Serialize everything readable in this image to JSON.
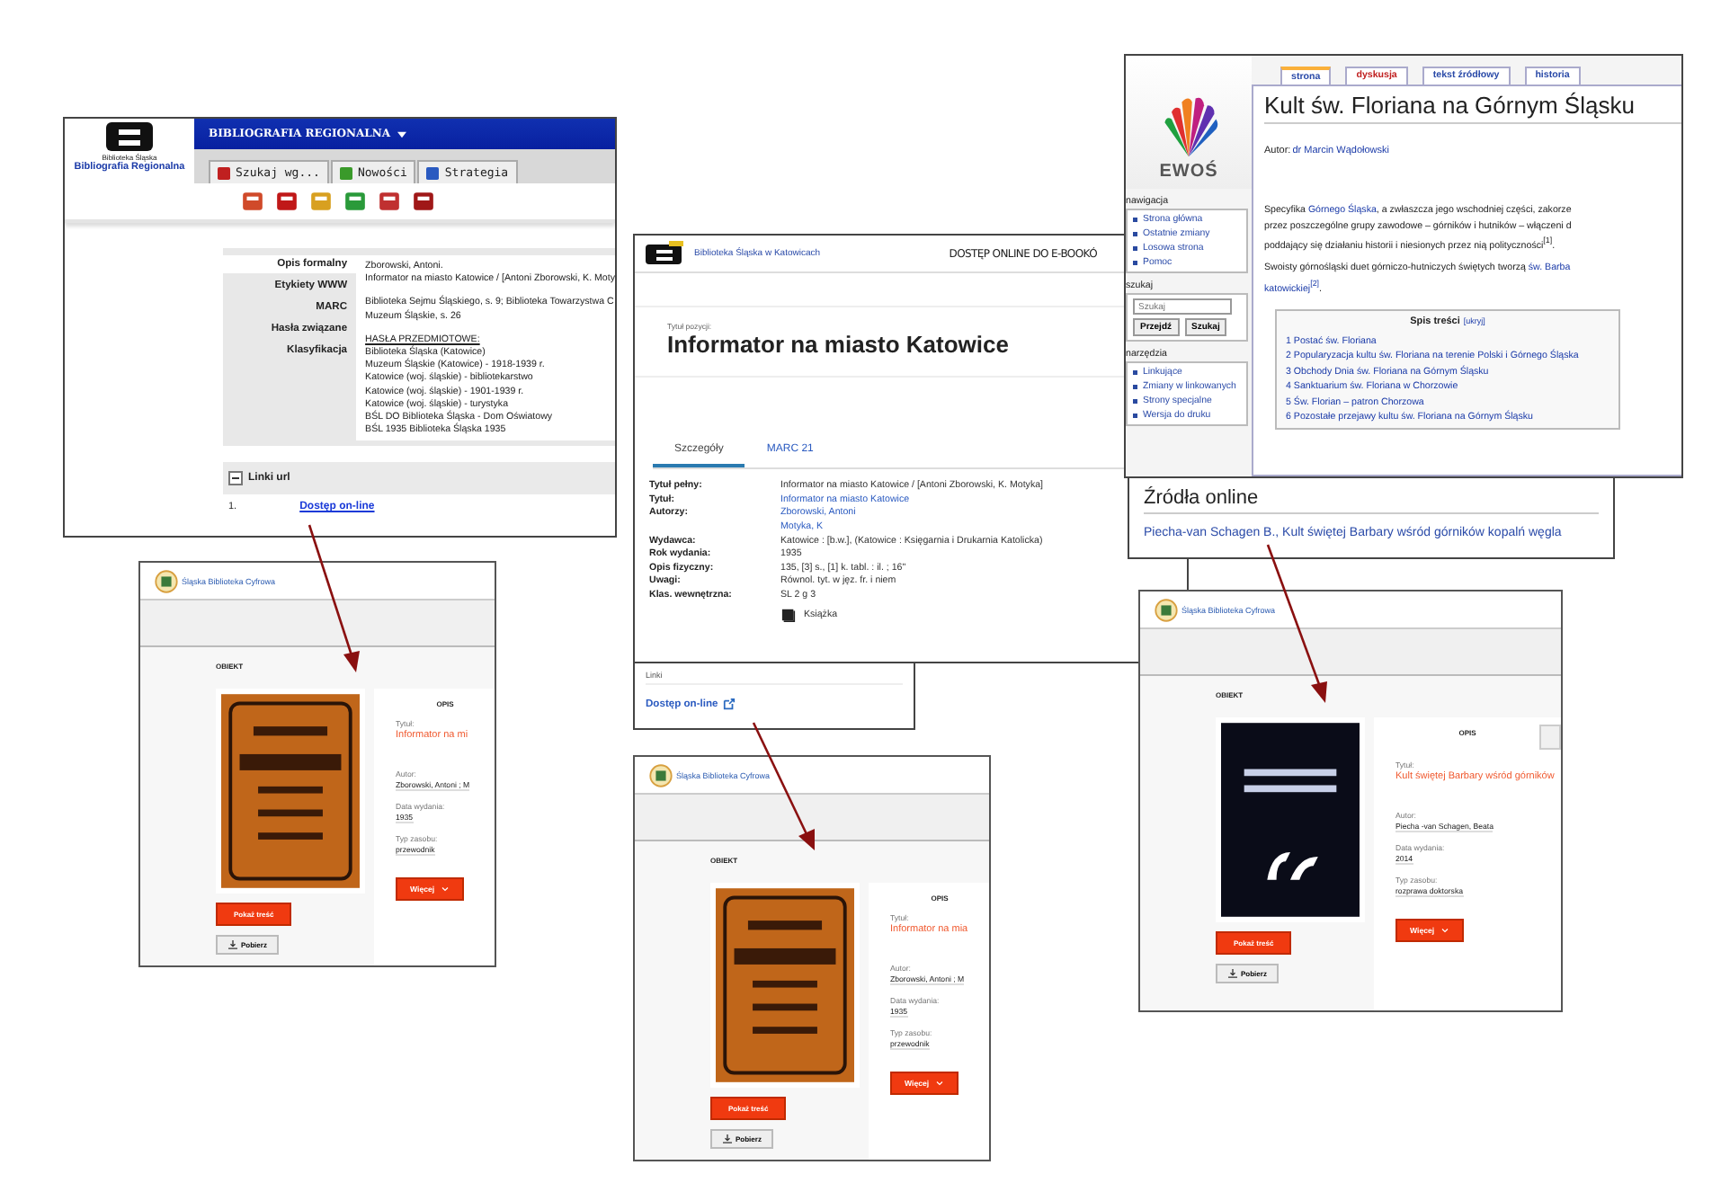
{
  "bibliography_window": {
    "logo_caption": "Biblioteka Śląska",
    "logo_title": "Bibliografia Regionalna",
    "menu_title": "BIBLIOGRAFIA REGIONALNA",
    "tabs": [
      {
        "label": "Szukaj wg...",
        "selected": false
      },
      {
        "label": "Nowości",
        "selected": false
      },
      {
        "label": "Strategia",
        "selected": false
      }
    ],
    "side_tabs": [
      {
        "label": "Opis formalny",
        "selected": true
      },
      {
        "label": "Etykiety WWW",
        "selected": false
      },
      {
        "label": "MARC",
        "selected": false
      },
      {
        "label": "Hasła związane",
        "selected": false
      },
      {
        "label": "Klasyfikacja",
        "selected": false
      }
    ],
    "record_groups": [
      [
        {
          "kind": "text",
          "text": "Zborowski, Antoni."
        },
        {
          "kind": "text",
          "text": "Informator na miasto Katowice / [Antoni Zborowski, K. Moty"
        }
      ],
      [
        {
          "kind": "text",
          "text": "Biblioteka Sejmu Śląskiego, s. 9; Biblioteka Towarzystwa C"
        },
        {
          "kind": "text",
          "text": "Muzeum Śląskie, s. 26"
        }
      ],
      [
        {
          "kind": "heading",
          "text": "HASŁA PRZEDMIOTOWE:"
        },
        {
          "kind": "text",
          "text": "Biblioteka Śląska (Katowice)"
        },
        {
          "kind": "text",
          "text": "Muzeum Śląskie (Katowice) - 1918-1939 r."
        },
        {
          "kind": "text",
          "text": "Katowice (woj. śląskie) - bibliotekarstwo"
        },
        {
          "kind": "text",
          "text": "Katowice (woj. śląskie) - 1901-1939 r."
        },
        {
          "kind": "text",
          "text": "Katowice (woj. śląskie) - turystyka"
        },
        {
          "kind": "text",
          "text": "BŚL DO Biblioteka Śląska - Dom Oświatowy"
        },
        {
          "kind": "text",
          "text": "BŚL 1935 Biblioteka Śląska 1935"
        }
      ]
    ],
    "links_title": "Linki url",
    "links": [
      {
        "number": "1.",
        "label": "Dostęp on-line"
      }
    ]
  },
  "catalog_window": {
    "brand": "Biblioteka Śląska w Katowicach",
    "header_text": "DOSTĘP ONLINE DO E-BOOKÓ",
    "title_caption": "Tytuł pozycji:",
    "title": "Informator na miasto Katowice",
    "tabs": [
      {
        "label": "Szczegóły",
        "selected": true
      },
      {
        "label": "MARC 21",
        "selected": false
      }
    ],
    "details": [
      {
        "label": "Tytuł pełny:",
        "kind": "text",
        "values": [
          "Informator na miasto Katowice / [Antoni Zborowski, K. Motyka]"
        ]
      },
      {
        "label": "Tytuł:",
        "kind": "link",
        "values": [
          "Informator na miasto Katowice"
        ]
      },
      {
        "label": "Autorzy:",
        "kind": "link",
        "values": [
          "Zborowski, Antoni",
          "Motyka, K"
        ]
      },
      {
        "label": "Wydawca:",
        "kind": "text",
        "values": [
          "Katowice : [b.w.], (Katowice : Księgarnia i Drukarnia Katolicka)"
        ]
      },
      {
        "label": "Rok wydania:",
        "kind": "text",
        "values": [
          "1935"
        ]
      },
      {
        "label": "Opis fizyczny:",
        "kind": "text",
        "values": [
          "135, [3] s., [1] k. tabl. : il. ; 16\""
        ]
      },
      {
        "label": "Uwagi:",
        "kind": "text",
        "values": [
          "Równol. tyt. w jęz. fr. i niem"
        ]
      },
      {
        "label": "Klas. wewnętrzna:",
        "kind": "text",
        "values": [
          "SL 2 g 3"
        ]
      }
    ],
    "format": "Książka",
    "links_title": "Linki",
    "link": "Dostęp on-line"
  },
  "wiki_window": {
    "logo_text": "EWOŚ",
    "sidebar": [
      {
        "kind": "links",
        "title": "nawigacja",
        "items": [
          "Strona główna",
          "Ostatnie zmiany",
          "Losowa strona",
          "Pomoc"
        ]
      },
      {
        "kind": "search",
        "title": "szukaj",
        "placeholder": "Szukaj",
        "buttons": [
          "Przejdź",
          "Szukaj"
        ]
      },
      {
        "kind": "links",
        "title": "narzędzia",
        "items": [
          "Linkujące",
          "Zmiany w linkowanych",
          "Strony specjalne",
          "Wersja do druku"
        ]
      }
    ],
    "tabs": [
      {
        "label": "strona",
        "selected": true,
        "missing": false
      },
      {
        "label": "dyskusja",
        "selected": false,
        "missing": true
      },
      {
        "label": "tekst źródłowy",
        "selected": false,
        "missing": false
      },
      {
        "label": "historia",
        "selected": false,
        "missing": false
      }
    ],
    "title": "Kult św. Floriana na Górnym Śląsku",
    "author_label": "Autor:",
    "author": "dr Marcin Wądołowski",
    "paragraphs": [
      [
        [
          {
            "text": "Specyfika ",
            "link": false
          },
          {
            "text": "Górnego Śląska",
            "link": true
          },
          {
            "text": ", a zwłaszcza jego wschodniej części, zakorze",
            "link": false
          }
        ],
        [
          {
            "text": "przez poszczególne grupy zawodowe – górników i hutników – włączeni d",
            "link": false
          }
        ],
        [
          {
            "text": "poddający się działaniu historii i niesionych przez nią polityczności$^{[1]}$.",
            "link": false
          }
        ]
      ],
      [
        [
          {
            "text": "Swoisty górnośląski duet górniczo-hutniczych świętych tworzą ",
            "link": false
          },
          {
            "text": "św. Barba",
            "link": true
          }
        ],
        [
          {
            "text": "katowickiej$^{[2]}$",
            "link": true
          },
          {
            "text": ".",
            "link": false
          }
        ]
      ]
    ],
    "toc_title": "Spis treści",
    "toc_toggle": "[ukryj]",
    "toc": [
      "1 Postać św. Floriana",
      "2 Popularyzacja kultu św. Floriana na terenie Polski i Górnego Śląska",
      "3 Obchody Dnia św. Floriana na Górnym Śląsku",
      "4 Sanktuarium św. Floriana w Chorzowie",
      "5 Św. Florian – patron Chorzowa",
      "6 Pozostałe przejawy kultu św. Floriana na Górnym Śląsku"
    ],
    "sources_title": "Źródła online",
    "source_link": "Piecha-van Schagen B., Kult świętej Barbary wśród górników kopalń węgla"
  },
  "digital_library_views": [
    {
      "logo_text": "Śląska Biblioteka Cyfrowa",
      "section": "OBIEKT",
      "kind": "booklet",
      "show_button": "Pokaż treść",
      "download_button": "Pobierz",
      "panel_title": "OPIS",
      "side_tab": false,
      "fields": [
        {
          "label": "Tytuł:",
          "value": "Informator na mi",
          "kind": "title"
        },
        {
          "label": "Autor:",
          "value": "Zborowski, Antoni ; M",
          "kind": "text"
        },
        {
          "label": "Data wydania:",
          "value": "1935",
          "kind": "text"
        },
        {
          "label": "Typ zasobu:",
          "value": "przewodnik",
          "kind": "text"
        }
      ],
      "more_button": "Więcej"
    },
    {
      "logo_text": "Śląska Biblioteka Cyfrowa",
      "section": "OBIEKT",
      "kind": "booklet",
      "show_button": "Pokaż treść",
      "download_button": "Pobierz",
      "panel_title": "OPIS",
      "side_tab": false,
      "fields": [
        {
          "label": "Tytuł:",
          "value": "Informator na mia",
          "kind": "title"
        },
        {
          "label": "Autor:",
          "value": "Zborowski, Antoni ; M",
          "kind": "text"
        },
        {
          "label": "Data wydania:",
          "value": "1935",
          "kind": "text"
        },
        {
          "label": "Typ zasobu:",
          "value": "przewodnik",
          "kind": "text"
        }
      ],
      "more_button": "Więcej"
    },
    {
      "logo_text": "Śląska Biblioteka Cyfrowa",
      "section": "OBIEKT",
      "kind": "thesis",
      "show_button": "Pokaż treść",
      "download_button": "Pobierz",
      "panel_title": "OPIS",
      "side_tab": true,
      "fields": [
        {
          "label": "Tytuł:",
          "value": "Kult świętej Barbary wśród górników",
          "kind": "title"
        },
        {
          "label": "Autor:",
          "value": "Piecha -van Schagen, Beata",
          "kind": "text"
        },
        {
          "label": "Data wydania:",
          "value": "2014",
          "kind": "text"
        },
        {
          "label": "Typ zasobu:",
          "value": "rozprawa doktorska",
          "kind": "text"
        }
      ],
      "more_button": "Więcej"
    }
  ]
}
